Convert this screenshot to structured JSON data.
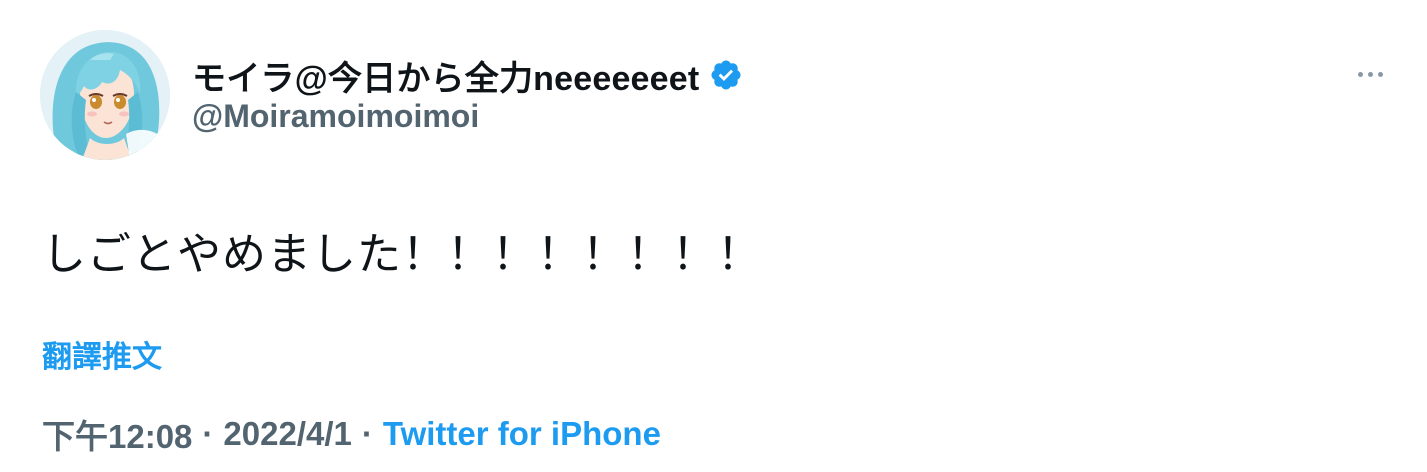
{
  "tweet": {
    "author": {
      "display_name": "モイラ@今日から全力neeeeeeet",
      "handle": "@Moiramoimoimoi",
      "verified": true,
      "avatar_icon": "anime-girl-avatar"
    },
    "text": "しごとやめました！！！！！！！！",
    "translate_label": "翻譯推文",
    "time": "下午12:08",
    "separator": "·",
    "date": "2022/4/1",
    "source": "Twitter for iPhone",
    "more_icon": "ellipsis-icon"
  },
  "colors": {
    "accent": "#1d9bf0",
    "text_primary": "#0f1419",
    "text_secondary": "#536471"
  }
}
